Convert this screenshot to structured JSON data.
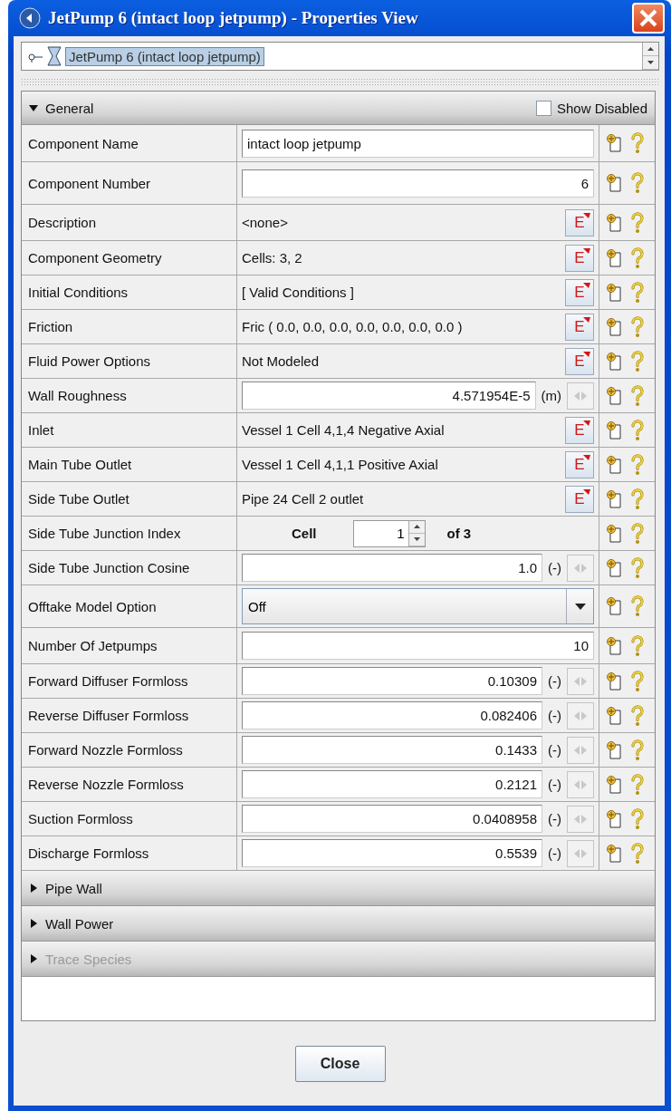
{
  "window": {
    "title": "JetPump 6 (intact loop jetpump) - Properties View"
  },
  "selector": {
    "value": "JetPump 6 (intact loop jetpump)"
  },
  "sections": [
    {
      "title": "General",
      "expanded": true,
      "disabled": false,
      "show_disabled": {
        "label": "Show Disabled",
        "checked": false
      },
      "rows": [
        {
          "kind": "text",
          "label": "Component Name",
          "value": "intact loop jetpump"
        },
        {
          "kind": "number",
          "label": "Component Number",
          "value": "6"
        },
        {
          "kind": "link",
          "label": "Description",
          "value": "<none>",
          "button": "E"
        },
        {
          "kind": "link",
          "label": "Component Geometry",
          "value": "Cells: 3, 2",
          "button": "E"
        },
        {
          "kind": "link",
          "label": "Initial Conditions",
          "value": "[ Valid Conditions ]",
          "button": "E"
        },
        {
          "kind": "link",
          "label": "Friction",
          "value": "Fric ( 0.0, 0.0, 0.0, 0.0, 0.0, 0.0, 0.0 )",
          "button": "E"
        },
        {
          "kind": "link",
          "label": "Fluid Power Options",
          "value": "Not Modeled",
          "button": "E"
        },
        {
          "kind": "unit",
          "label": "Wall Roughness",
          "value": "4.571954E-5",
          "unit": "(m)"
        },
        {
          "kind": "link",
          "label": "Inlet",
          "value": "Vessel 1 Cell 4,1,4 Negative Axial",
          "button": "E"
        },
        {
          "kind": "link",
          "label": "Main Tube Outlet",
          "value": "Vessel 1 Cell 4,1,1 Positive Axial",
          "button": "E"
        },
        {
          "kind": "link",
          "label": "Side Tube Outlet",
          "value": "Pipe 24 Cell 2 outlet",
          "button": "E"
        },
        {
          "kind": "spinner",
          "label": "Side Tube Junction Index",
          "prefix": "Cell",
          "value": "1",
          "suffix": "of 3"
        },
        {
          "kind": "unit",
          "label": "Side Tube Junction Cosine",
          "value": "1.0",
          "unit": "(-)"
        },
        {
          "kind": "dropdown",
          "label": "Offtake Model Option",
          "value": "Off"
        },
        {
          "kind": "number",
          "label": "Number Of Jetpumps",
          "value": "10"
        },
        {
          "kind": "unit",
          "label": "Forward Diffuser Formloss",
          "value": "0.10309",
          "unit": "(-)"
        },
        {
          "kind": "unit",
          "label": "Reverse Diffuser Formloss",
          "value": "0.082406",
          "unit": "(-)"
        },
        {
          "kind": "unit",
          "label": "Forward Nozzle Formloss",
          "value": "0.1433",
          "unit": "(-)"
        },
        {
          "kind": "unit",
          "label": "Reverse Nozzle Formloss",
          "value": "0.2121",
          "unit": "(-)"
        },
        {
          "kind": "unit",
          "label": "Suction Formloss",
          "value": "0.0408958",
          "unit": "(-)"
        },
        {
          "kind": "unit",
          "label": "Discharge Formloss",
          "value": "0.5539",
          "unit": "(-)"
        }
      ]
    },
    {
      "title": "Pipe Wall",
      "expanded": false,
      "disabled": false
    },
    {
      "title": "Wall Power",
      "expanded": false,
      "disabled": false
    },
    {
      "title": "Trace Species",
      "expanded": false,
      "disabled": true
    }
  ],
  "buttons": [
    "Close"
  ]
}
